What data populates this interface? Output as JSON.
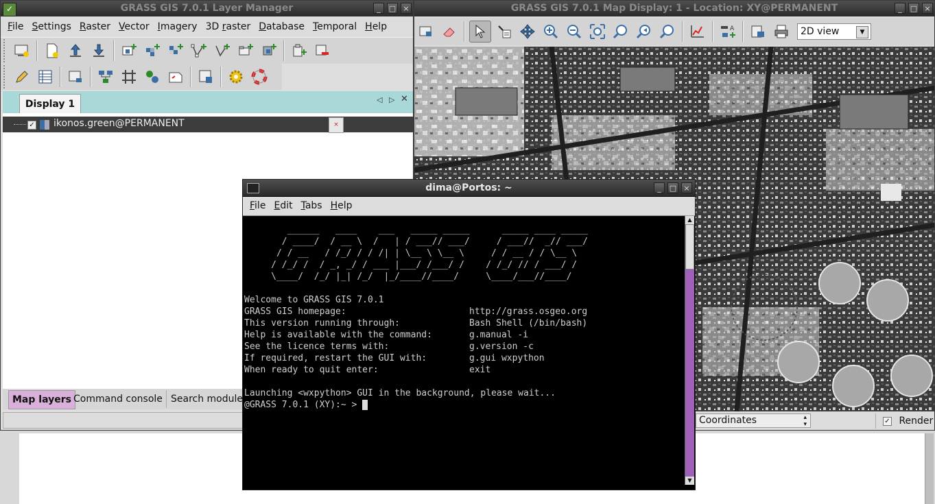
{
  "layer_manager": {
    "title": "GRASS GIS 7.0.1 Layer Manager",
    "menu": [
      {
        "pre": "",
        "u": "F",
        "post": "ile"
      },
      {
        "pre": "",
        "u": "S",
        "post": "ettings"
      },
      {
        "pre": "",
        "u": "R",
        "post": "aster"
      },
      {
        "pre": "",
        "u": "V",
        "post": "ector"
      },
      {
        "pre": "",
        "u": "I",
        "post": "magery"
      },
      {
        "pre": "3D ",
        "u": "r",
        "post": "aster"
      },
      {
        "pre": "",
        "u": "D",
        "post": "atabase"
      },
      {
        "pre": "",
        "u": "T",
        "post": "emporal"
      },
      {
        "pre": "",
        "u": "H",
        "post": "elp"
      }
    ],
    "display_tab": "Display 1",
    "layer": {
      "name": "ikonos.green@PERMANENT",
      "checked": true
    },
    "bottom_tabs": [
      "Map layers",
      "Command console",
      "Search modules"
    ]
  },
  "map_display": {
    "title": "GRASS GIS 7.0.1 Map Display: 1  - Location: XY@PERMANENT",
    "view_mode": "2D view",
    "statusbar_mode": "Coordinates",
    "render_label": "Render",
    "render_checked": true
  },
  "terminal": {
    "title": "dima@Portos: ~",
    "menu": [
      {
        "u": "F",
        "post": "ile"
      },
      {
        "u": "E",
        "post": "dit"
      },
      {
        "u": "T",
        "post": "abs"
      },
      {
        "u": "H",
        "post": "elp"
      }
    ],
    "logo": [
      "        ______   ____    ___   _____ _____      _____ ____ _____",
      "       / ____/  / __ \\  /   | / ___// ___/     / ___//  _// ___/",
      "      / / __   / /_/ / / /| | \\__ \\ \\__ \\     / / __ / / \\__ \\ ",
      "     / /_/ /  / _, _/ / ___ |___/ /___/ /    / /_/ // / ___/ / ",
      "     \\____/  /_/ |_| /_/  |_/____//____/     \\____/___//____/  "
    ],
    "welcome": "Welcome to GRASS GIS 7.0.1",
    "info": [
      {
        "k": "GRASS GIS homepage:",
        "v": "http://grass.osgeo.org"
      },
      {
        "k": "This version running through:",
        "v": "Bash Shell (/bin/bash)"
      },
      {
        "k": "Help is available with the command:",
        "v": "g.manual -i"
      },
      {
        "k": "See the licence terms with:",
        "v": "g.version -c"
      },
      {
        "k": "If required, restart the GUI with:",
        "v": "g.gui wxpython"
      },
      {
        "k": "When ready to quit enter:",
        "v": "exit"
      }
    ],
    "launching": "Launching <wxpython> GUI in the background, please wait...",
    "prompt": "@GRASS 7.0.1 (XY):~ > "
  }
}
